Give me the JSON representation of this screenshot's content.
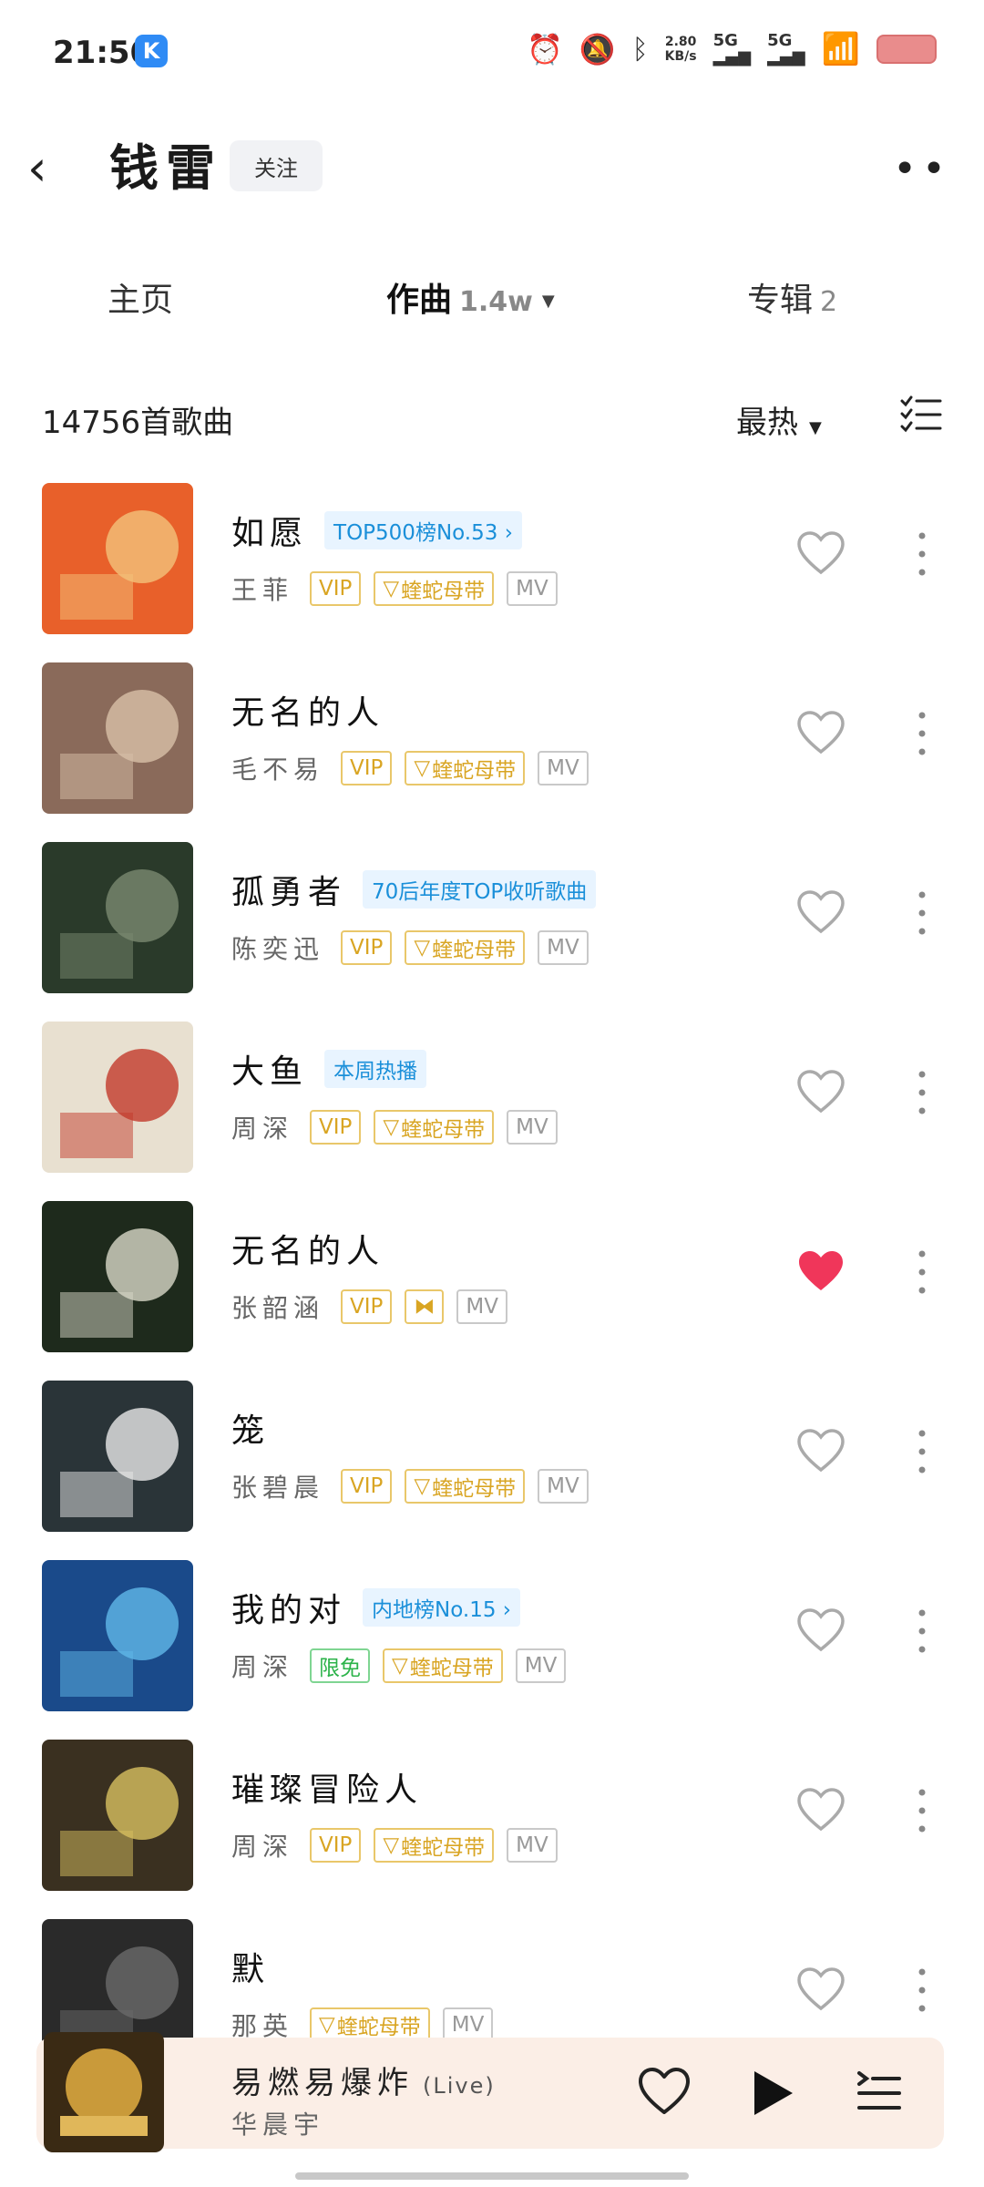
{
  "status": {
    "time": "21:50",
    "app_badge": "K",
    "net_speed_value": "2.80",
    "net_speed_unit": "KB/s",
    "sig1": "5G",
    "sig2": "5G"
  },
  "header": {
    "back_glyph": "‹",
    "artist": "钱雷",
    "follow_label": "关注",
    "more_glyph": "••"
  },
  "tabs": [
    {
      "label": "主页",
      "count": ""
    },
    {
      "label": "作曲",
      "count": "1.4w"
    },
    {
      "label": "专辑",
      "count": "2"
    }
  ],
  "list": {
    "count_label": "14756首歌曲",
    "sort_label": "最热"
  },
  "songs": [
    {
      "title": "如愿",
      "tag": "TOP500榜No.53 ›",
      "singer": "王菲",
      "badges": [
        "VIP",
        "蝰蛇母带",
        "MV"
      ],
      "liked": false
    },
    {
      "title": "无名的人",
      "tag": "",
      "singer": "毛不易",
      "badges": [
        "VIP",
        "蝰蛇母带",
        "MV"
      ],
      "liked": false
    },
    {
      "title": "孤勇者",
      "tag": "70后年度TOP收听歌曲",
      "singer": "陈奕迅",
      "badges": [
        "VIP",
        "蝰蛇母带",
        "MV"
      ],
      "liked": false
    },
    {
      "title": "大鱼",
      "tag": "本周热播",
      "singer": "周深",
      "badges": [
        "VIP",
        "蝰蛇母带",
        "MV"
      ],
      "liked": false
    },
    {
      "title": "无名的人",
      "tag": "",
      "singer": "张韶涵",
      "badges": [
        "VIP",
        "",
        "MV"
      ],
      "liked": true
    },
    {
      "title": "笼",
      "tag": "",
      "singer": "张碧晨",
      "badges": [
        "VIP",
        "蝰蛇母带",
        "MV"
      ],
      "liked": false
    },
    {
      "title": "我的对",
      "tag": "内地榜No.15 ›",
      "singer": "周深",
      "badges": [
        "限免",
        "蝰蛇母带",
        "MV"
      ],
      "liked": false
    },
    {
      "title": "璀璨冒险人",
      "tag": "",
      "singer": "周深",
      "badges": [
        "VIP",
        "蝰蛇母带",
        "MV"
      ],
      "liked": false
    },
    {
      "title": "默",
      "tag": "",
      "singer": "那英",
      "badges": [
        "蝰蛇母带",
        "MV"
      ],
      "liked": false
    }
  ],
  "player": {
    "title": "易燃易爆炸",
    "live": "(Live)",
    "artist": "华晨宇"
  },
  "colors": {
    "accent": "#1a8fd9",
    "like": "#f0365a",
    "vip": "#d9a523",
    "free": "#2cb34a",
    "player_bg": "#fbeee6"
  },
  "icons": [
    "back-icon",
    "more-icon",
    "list-icon",
    "heart-icon",
    "more-vertical-icon",
    "play-icon",
    "playlist-icon"
  ]
}
